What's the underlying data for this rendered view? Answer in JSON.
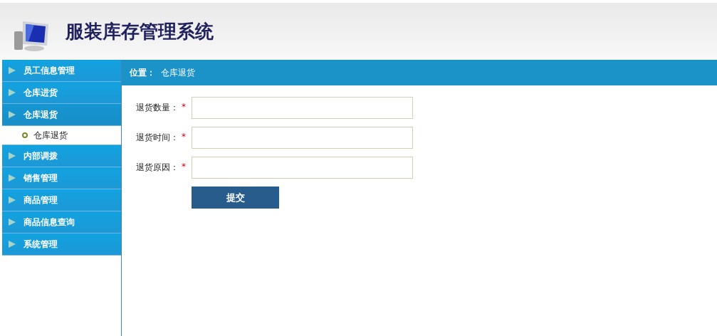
{
  "header": {
    "title": "服装库存管理系统"
  },
  "sidebar": {
    "items": [
      {
        "label": "员工信息管理",
        "expanded": false
      },
      {
        "label": "仓库进货",
        "expanded": false
      },
      {
        "label": "仓库退货",
        "expanded": true,
        "children": [
          {
            "label": "仓库退货"
          }
        ]
      },
      {
        "label": "内部调拨",
        "expanded": false
      },
      {
        "label": "销售管理",
        "expanded": false
      },
      {
        "label": "商品管理",
        "expanded": false
      },
      {
        "label": "商品信息查询",
        "expanded": false
      },
      {
        "label": "系统管理",
        "expanded": false
      }
    ]
  },
  "breadcrumb": {
    "label": "位置：",
    "current": "仓库退货"
  },
  "form": {
    "fields": [
      {
        "label": "退货数量：",
        "required_mark": "*"
      },
      {
        "label": "退货时间：",
        "required_mark": "*"
      },
      {
        "label": "退货原因：",
        "required_mark": "*"
      }
    ],
    "submit": "提交"
  }
}
